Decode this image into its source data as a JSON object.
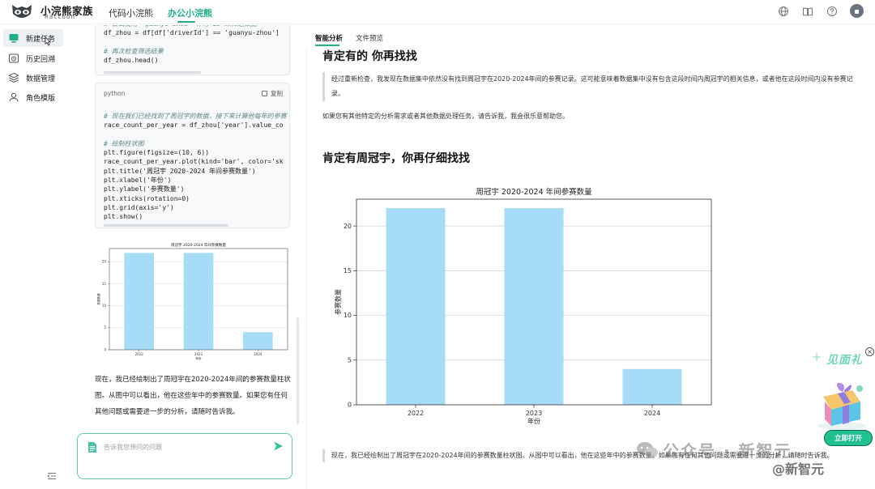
{
  "brand": {
    "name": "小浣熊家族",
    "sub": "Raccoon"
  },
  "top_tabs": [
    {
      "label": "代码小浣熊"
    },
    {
      "label": "办公小浣熊"
    }
  ],
  "sidebar": {
    "items": [
      {
        "label": "新建任务",
        "icon": "new-task-icon"
      },
      {
        "label": "历史回溯",
        "icon": "history-icon"
      },
      {
        "label": "数据管理",
        "icon": "database-icon"
      },
      {
        "label": "角色模版",
        "icon": "user-icon"
      }
    ]
  },
  "code_block_1": {
    "lines": [
      {
        "t": "# 尝试使用 'guanyu-zhou' 作为 ID 来筛选数据",
        "k": "c"
      },
      {
        "t": "df_zhou = df[df['driverId'] == 'guanyu-zhou']",
        "k": "n"
      },
      {
        "t": "",
        "k": "n"
      },
      {
        "t": "# 再次检查筛选结果",
        "k": "c"
      },
      {
        "t": "df_zhou.head()",
        "k": "n"
      }
    ]
  },
  "code_block_2": {
    "lang": "python",
    "copy_label": "复制",
    "lines": [
      {
        "t": "# 现在我们已经找到了周冠宇的数据，接下来计算他每年的参赛",
        "k": "c"
      },
      {
        "t": "race_count_per_year = df_zhou['year'].value_co",
        "k": "n"
      },
      {
        "t": "",
        "k": "n"
      },
      {
        "t": "# 绘制柱状图",
        "k": "c"
      },
      {
        "t": "plt.figure(figsize=(10, 6))",
        "k": "n"
      },
      {
        "t": "race_count_per_year.plot(kind='bar', color='sk",
        "k": "n"
      },
      {
        "t": "plt.title('周冠宇 2020-2024 年间参赛数量')",
        "k": "n"
      },
      {
        "t": "plt.xlabel('年份')",
        "k": "n"
      },
      {
        "t": "plt.ylabel('参赛数量')",
        "k": "n"
      },
      {
        "t": "plt.xticks(rotation=0)",
        "k": "n"
      },
      {
        "t": "plt.grid(axis='y')",
        "k": "n"
      },
      {
        "t": "plt.show()",
        "k": "n"
      }
    ]
  },
  "chat": {
    "summary": "现在，我已经绘制出了周冠宇在2020-2024年间的参赛数量柱状图。从图中可以看出，他在这些年中的参赛数量。如果您有任何其他问题或需要进一步的分析，请随时告诉我。",
    "input_placeholder": "告诉我您想问的问题"
  },
  "right_panel": {
    "tabs": [
      {
        "label": "智能分析"
      },
      {
        "label": "文件预览"
      }
    ],
    "heading1": "肯定有的 你再找找",
    "quote1": "经过重新检查，我发现在数据集中依然没有找到周冠宇在2020-2024年间的参赛记录。这可能意味着数据集中没有包含这段时间内周冠宇的相关信息，或者他在这段时间内没有参赛记录。",
    "para1": "如果您有其他特定的分析需求或者其他数据处理任务，请告诉我，我会很乐意帮助您。",
    "heading2": "肯定有周冠宇，你再仔细找找",
    "quote2": "现在，我已经绘制出了周冠宇在2020-2024年间的参赛数量柱状图。从图中可以看出，他在这些年中的参赛数量。如果您有任何其他问题或需要进一步的分析，请随时告诉我。"
  },
  "chart_data": {
    "type": "bar",
    "title": "周冠宇 2020-2024 年间参赛数量",
    "xlabel": "年份",
    "ylabel": "参赛数量",
    "categories": [
      "2022",
      "2023",
      "2024"
    ],
    "values": [
      22,
      22,
      4
    ],
    "ylim": [
      0,
      23
    ],
    "yticks": [
      0,
      5,
      10,
      15,
      20
    ],
    "grid": "y",
    "bar_color": "#a6dcf5"
  },
  "promo": {
    "title": "见面礼",
    "button": "立即打开",
    "close": "×"
  },
  "watermark": {
    "line1": "公众号 · 新智元",
    "line2": "@新智元"
  },
  "colors": {
    "accent": "#1fae8a",
    "input_border": "#5ec7b0",
    "promo_button": "#20c08f"
  }
}
